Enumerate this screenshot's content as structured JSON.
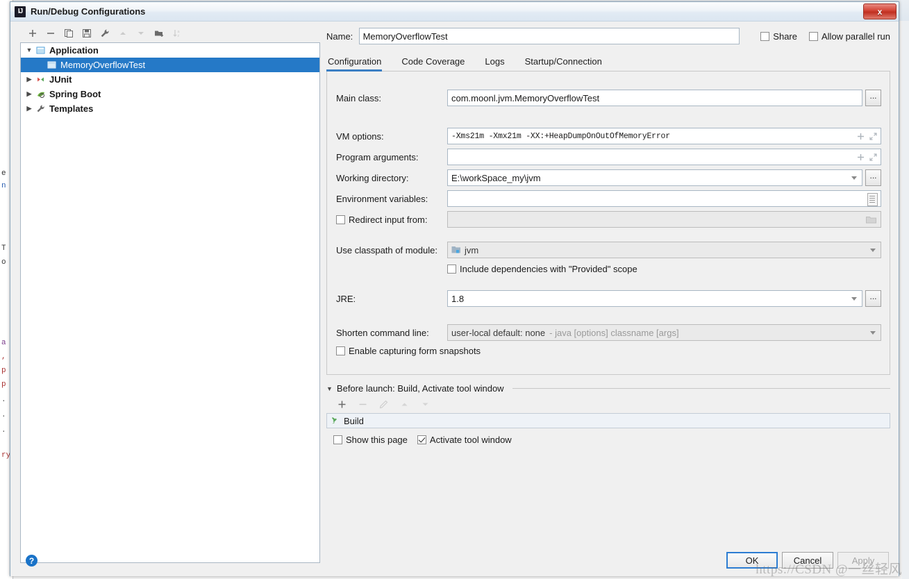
{
  "window": {
    "title": "Run/Debug Configurations",
    "logo_text": "IJ",
    "close_label": "x"
  },
  "tree_toolbar": {
    "buttons": [
      {
        "name": "add-configuration-button",
        "icon": "plus-icon",
        "disabled": false
      },
      {
        "name": "remove-configuration-button",
        "icon": "minus-icon",
        "disabled": false
      },
      {
        "name": "copy-configuration-button",
        "icon": "copy-icon",
        "disabled": false
      },
      {
        "name": "save-configuration-button",
        "icon": "save-icon",
        "disabled": false
      },
      {
        "name": "edit-templates-button",
        "icon": "wrench-icon",
        "disabled": false
      },
      {
        "name": "move-up-button",
        "icon": "arrow-up-icon",
        "disabled": true
      },
      {
        "name": "move-down-button",
        "icon": "arrow-down-icon",
        "disabled": true
      },
      {
        "name": "create-folder-button",
        "icon": "folder-add-icon",
        "disabled": false
      },
      {
        "name": "sort-configurations-button",
        "icon": "sort-az-icon",
        "disabled": true
      }
    ]
  },
  "tree": {
    "items": [
      {
        "label": "Application",
        "level": 0,
        "expanded": true,
        "icon": "application-icon",
        "selected": false
      },
      {
        "label": "MemoryOverflowTest",
        "level": 1,
        "expanded": null,
        "icon": "application-icon",
        "selected": true
      },
      {
        "label": "JUnit",
        "level": 0,
        "expanded": false,
        "icon": "junit-icon",
        "selected": false
      },
      {
        "label": "Spring Boot",
        "level": 0,
        "expanded": false,
        "icon": "spring-boot-icon",
        "selected": false
      },
      {
        "label": "Templates",
        "level": 0,
        "expanded": false,
        "icon": "wrench-icon",
        "selected": false
      }
    ]
  },
  "name_row": {
    "label": "Name:",
    "value": "MemoryOverflowTest",
    "share": {
      "label": "Share",
      "checked": false
    },
    "allow_parallel": {
      "label": "Allow parallel run",
      "checked": false
    }
  },
  "tabs": [
    {
      "label": "Configuration",
      "active": true
    },
    {
      "label": "Code Coverage",
      "active": false
    },
    {
      "label": "Logs",
      "active": false
    },
    {
      "label": "Startup/Connection",
      "active": false
    }
  ],
  "form": {
    "main_class": {
      "label": "Main class:",
      "value": "com.moonl.jvm.MemoryOverflowTest",
      "browse": "..."
    },
    "vm_options": {
      "label": "VM options:",
      "value": "-Xms21m -Xmx21m -XX:+HeapDumpOnOutOfMemoryError"
    },
    "program_arguments": {
      "label": "Program arguments:",
      "value": ""
    },
    "working_directory": {
      "label": "Working directory:",
      "value": "E:\\workSpace_my\\jvm",
      "browse": "..."
    },
    "environment_variables": {
      "label": "Environment variables:",
      "value": ""
    },
    "redirect_input": {
      "label": "Redirect input from:",
      "value": "",
      "checked": false
    },
    "use_classpath_of_module": {
      "label": "Use classpath of module:",
      "value": "jvm"
    },
    "include_provided": {
      "label": "Include dependencies with \"Provided\" scope",
      "checked": false
    },
    "jre": {
      "label": "JRE:",
      "value": "1.8",
      "browse": "..."
    },
    "shorten_command_line": {
      "label": "Shorten command line:",
      "value": "user-local default: none",
      "value_suffix": "- java [options] classname [args]"
    },
    "enable_form_snapshots": {
      "label": "Enable capturing form snapshots",
      "checked": false
    }
  },
  "before_launch": {
    "title": "Before launch: Build, Activate tool window",
    "toolbar": [
      {
        "name": "before-launch-add-button",
        "icon": "plus-icon",
        "disabled": false
      },
      {
        "name": "before-launch-remove-button",
        "icon": "minus-icon",
        "disabled": true
      },
      {
        "name": "before-launch-edit-button",
        "icon": "pencil-icon",
        "disabled": true
      },
      {
        "name": "before-launch-move-up-button",
        "icon": "arrow-up-icon",
        "disabled": true
      },
      {
        "name": "before-launch-move-down-button",
        "icon": "arrow-down-icon",
        "disabled": true
      }
    ],
    "tasks": [
      {
        "label": "Build",
        "icon": "build-hammer-icon"
      }
    ],
    "show_this_page": {
      "label": "Show this page",
      "checked": false
    },
    "activate_tool_window": {
      "label": "Activate tool window",
      "checked": true
    }
  },
  "footer": {
    "help_label": "?",
    "ok_label": "OK",
    "cancel_label": "Cancel",
    "apply_label": "Apply"
  },
  "watermark": "https://CSDN @一丝轻风",
  "colors": {
    "selection_blue": "#2579c7",
    "tab_underline": "#3b7fc4",
    "default_button_border": "#2d7dd2",
    "build_icon_green": "#5aa85a",
    "junit_icon_red": "#d9534f",
    "close_button_red": "#c02f20"
  }
}
